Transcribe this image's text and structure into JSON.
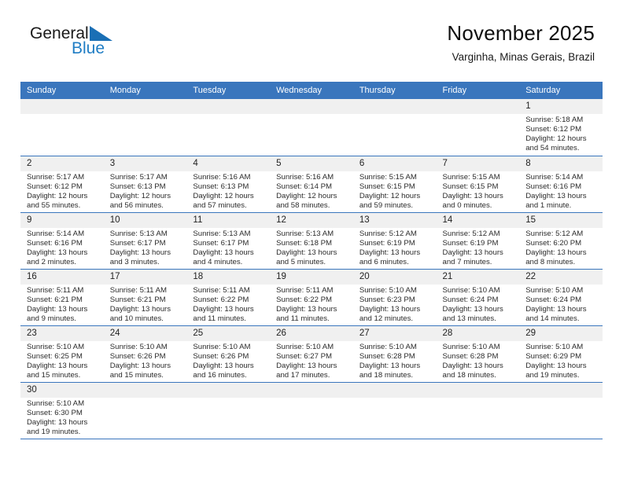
{
  "logo": {
    "word_one": "General",
    "word_two": "Blue",
    "flag_icon": "blue-triangle-flag-icon",
    "accent_color": "#1f7dc4"
  },
  "header": {
    "title": "November 2025",
    "subtitle": "Varginha, Minas Gerais, Brazil"
  },
  "theme": {
    "header_blue": "#3a76bd",
    "daynum_gray": "#f0f0f0",
    "text": "#2b2b2b"
  },
  "calendar": {
    "weekday_headers": [
      "Sunday",
      "Monday",
      "Tuesday",
      "Wednesday",
      "Thursday",
      "Friday",
      "Saturday"
    ],
    "weeks": [
      [
        {
          "day": "",
          "empty": true
        },
        {
          "day": "",
          "empty": true
        },
        {
          "day": "",
          "empty": true
        },
        {
          "day": "",
          "empty": true
        },
        {
          "day": "",
          "empty": true
        },
        {
          "day": "",
          "empty": true
        },
        {
          "day": "1",
          "sunrise": "Sunrise: 5:18 AM",
          "sunset": "Sunset: 6:12 PM",
          "daylight": "Daylight: 12 hours and 54 minutes."
        }
      ],
      [
        {
          "day": "2",
          "sunrise": "Sunrise: 5:17 AM",
          "sunset": "Sunset: 6:12 PM",
          "daylight": "Daylight: 12 hours and 55 minutes."
        },
        {
          "day": "3",
          "sunrise": "Sunrise: 5:17 AM",
          "sunset": "Sunset: 6:13 PM",
          "daylight": "Daylight: 12 hours and 56 minutes."
        },
        {
          "day": "4",
          "sunrise": "Sunrise: 5:16 AM",
          "sunset": "Sunset: 6:13 PM",
          "daylight": "Daylight: 12 hours and 57 minutes."
        },
        {
          "day": "5",
          "sunrise": "Sunrise: 5:16 AM",
          "sunset": "Sunset: 6:14 PM",
          "daylight": "Daylight: 12 hours and 58 minutes."
        },
        {
          "day": "6",
          "sunrise": "Sunrise: 5:15 AM",
          "sunset": "Sunset: 6:15 PM",
          "daylight": "Daylight: 12 hours and 59 minutes."
        },
        {
          "day": "7",
          "sunrise": "Sunrise: 5:15 AM",
          "sunset": "Sunset: 6:15 PM",
          "daylight": "Daylight: 13 hours and 0 minutes."
        },
        {
          "day": "8",
          "sunrise": "Sunrise: 5:14 AM",
          "sunset": "Sunset: 6:16 PM",
          "daylight": "Daylight: 13 hours and 1 minute."
        }
      ],
      [
        {
          "day": "9",
          "sunrise": "Sunrise: 5:14 AM",
          "sunset": "Sunset: 6:16 PM",
          "daylight": "Daylight: 13 hours and 2 minutes."
        },
        {
          "day": "10",
          "sunrise": "Sunrise: 5:13 AM",
          "sunset": "Sunset: 6:17 PM",
          "daylight": "Daylight: 13 hours and 3 minutes."
        },
        {
          "day": "11",
          "sunrise": "Sunrise: 5:13 AM",
          "sunset": "Sunset: 6:17 PM",
          "daylight": "Daylight: 13 hours and 4 minutes."
        },
        {
          "day": "12",
          "sunrise": "Sunrise: 5:13 AM",
          "sunset": "Sunset: 6:18 PM",
          "daylight": "Daylight: 13 hours and 5 minutes."
        },
        {
          "day": "13",
          "sunrise": "Sunrise: 5:12 AM",
          "sunset": "Sunset: 6:19 PM",
          "daylight": "Daylight: 13 hours and 6 minutes."
        },
        {
          "day": "14",
          "sunrise": "Sunrise: 5:12 AM",
          "sunset": "Sunset: 6:19 PM",
          "daylight": "Daylight: 13 hours and 7 minutes."
        },
        {
          "day": "15",
          "sunrise": "Sunrise: 5:12 AM",
          "sunset": "Sunset: 6:20 PM",
          "daylight": "Daylight: 13 hours and 8 minutes."
        }
      ],
      [
        {
          "day": "16",
          "sunrise": "Sunrise: 5:11 AM",
          "sunset": "Sunset: 6:21 PM",
          "daylight": "Daylight: 13 hours and 9 minutes."
        },
        {
          "day": "17",
          "sunrise": "Sunrise: 5:11 AM",
          "sunset": "Sunset: 6:21 PM",
          "daylight": "Daylight: 13 hours and 10 minutes."
        },
        {
          "day": "18",
          "sunrise": "Sunrise: 5:11 AM",
          "sunset": "Sunset: 6:22 PM",
          "daylight": "Daylight: 13 hours and 11 minutes."
        },
        {
          "day": "19",
          "sunrise": "Sunrise: 5:11 AM",
          "sunset": "Sunset: 6:22 PM",
          "daylight": "Daylight: 13 hours and 11 minutes."
        },
        {
          "day": "20",
          "sunrise": "Sunrise: 5:10 AM",
          "sunset": "Sunset: 6:23 PM",
          "daylight": "Daylight: 13 hours and 12 minutes."
        },
        {
          "day": "21",
          "sunrise": "Sunrise: 5:10 AM",
          "sunset": "Sunset: 6:24 PM",
          "daylight": "Daylight: 13 hours and 13 minutes."
        },
        {
          "day": "22",
          "sunrise": "Sunrise: 5:10 AM",
          "sunset": "Sunset: 6:24 PM",
          "daylight": "Daylight: 13 hours and 14 minutes."
        }
      ],
      [
        {
          "day": "23",
          "sunrise": "Sunrise: 5:10 AM",
          "sunset": "Sunset: 6:25 PM",
          "daylight": "Daylight: 13 hours and 15 minutes."
        },
        {
          "day": "24",
          "sunrise": "Sunrise: 5:10 AM",
          "sunset": "Sunset: 6:26 PM",
          "daylight": "Daylight: 13 hours and 15 minutes."
        },
        {
          "day": "25",
          "sunrise": "Sunrise: 5:10 AM",
          "sunset": "Sunset: 6:26 PM",
          "daylight": "Daylight: 13 hours and 16 minutes."
        },
        {
          "day": "26",
          "sunrise": "Sunrise: 5:10 AM",
          "sunset": "Sunset: 6:27 PM",
          "daylight": "Daylight: 13 hours and 17 minutes."
        },
        {
          "day": "27",
          "sunrise": "Sunrise: 5:10 AM",
          "sunset": "Sunset: 6:28 PM",
          "daylight": "Daylight: 13 hours and 18 minutes."
        },
        {
          "day": "28",
          "sunrise": "Sunrise: 5:10 AM",
          "sunset": "Sunset: 6:28 PM",
          "daylight": "Daylight: 13 hours and 18 minutes."
        },
        {
          "day": "29",
          "sunrise": "Sunrise: 5:10 AM",
          "sunset": "Sunset: 6:29 PM",
          "daylight": "Daylight: 13 hours and 19 minutes."
        }
      ],
      [
        {
          "day": "30",
          "sunrise": "Sunrise: 5:10 AM",
          "sunset": "Sunset: 6:30 PM",
          "daylight": "Daylight: 13 hours and 19 minutes."
        },
        {
          "day": "",
          "empty": true
        },
        {
          "day": "",
          "empty": true
        },
        {
          "day": "",
          "empty": true
        },
        {
          "day": "",
          "empty": true
        },
        {
          "day": "",
          "empty": true
        },
        {
          "day": "",
          "empty": true
        }
      ]
    ]
  }
}
